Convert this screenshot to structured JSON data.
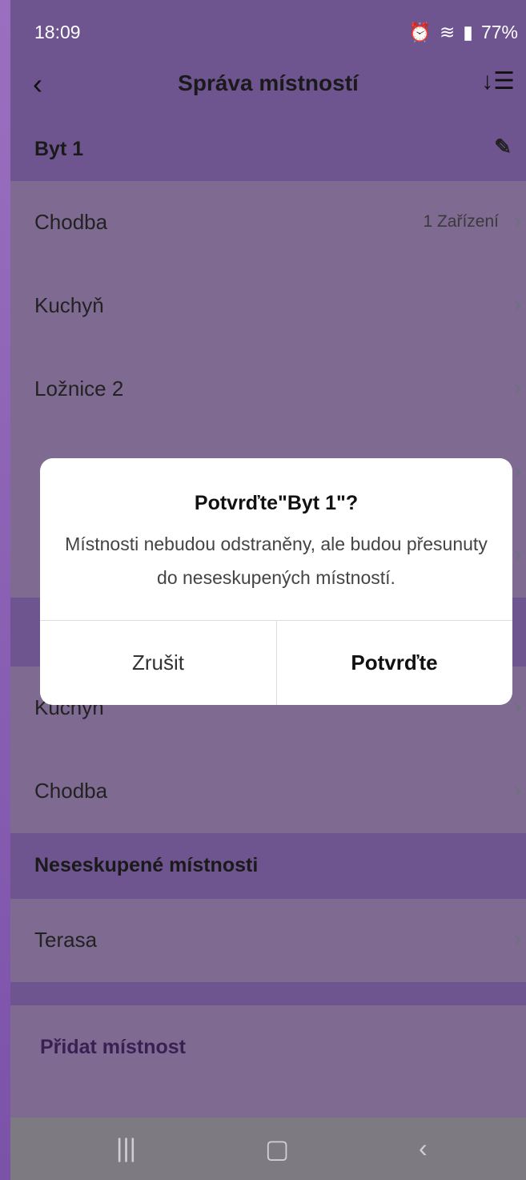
{
  "status": {
    "time": "18:09",
    "battery": "77%"
  },
  "appbar": {
    "title": "Správa místností"
  },
  "groups": [
    {
      "name": "Byt 1",
      "rooms": [
        {
          "name": "Chodba",
          "meta": "1 Zařízení"
        },
        {
          "name": "Kuchyň",
          "meta": ""
        },
        {
          "name": "Ložnice 2",
          "meta": ""
        }
      ]
    },
    {
      "name": "",
      "rooms": [
        {
          "name": "Kuchyň",
          "meta": ""
        },
        {
          "name": "Chodba",
          "meta": ""
        }
      ]
    }
  ],
  "ungrouped": {
    "title": "Neseskupené místnosti",
    "rooms": [
      {
        "name": "Terasa"
      }
    ]
  },
  "add_room": "Přidat místnost",
  "dialog": {
    "title": "Potvrďte\"Byt 1\"?",
    "message": "Místnosti nebudou odstraněny, ale budou přesunuty do neseskupených místností.",
    "cancel": "Zrušit",
    "confirm": "Potvrďte"
  }
}
